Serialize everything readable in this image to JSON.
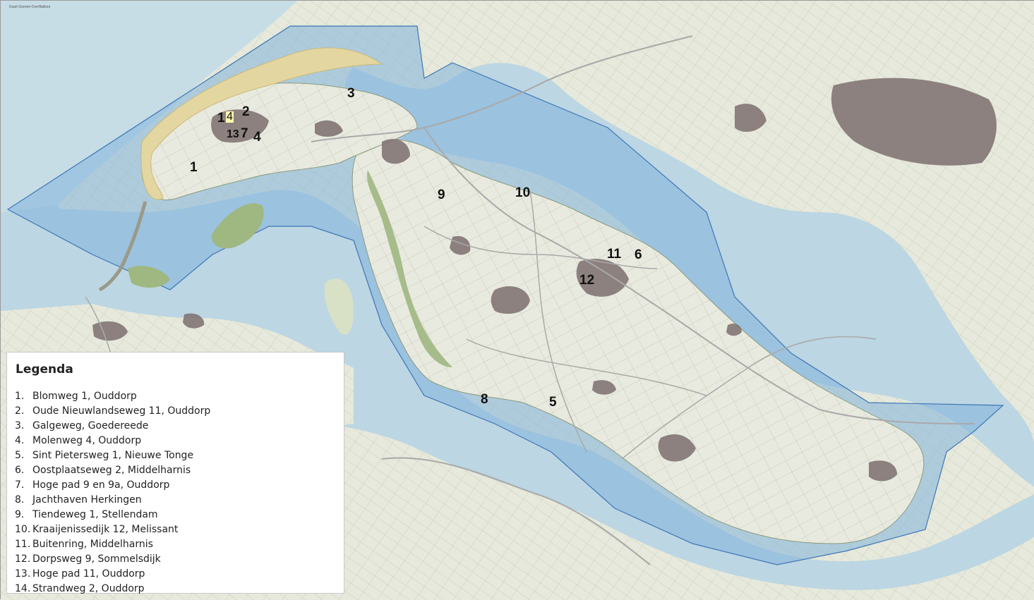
{
  "map": {
    "top_left_caption": "Kaart Goeree-Overflakkee",
    "colors": {
      "land": "#e9eadf",
      "water": "#bcd6e3",
      "deep_water": "#8fb8d6",
      "boundary_fill": "#7fb2dc",
      "boundary_line": "#3f76b5",
      "forest": "#9fb781",
      "dune": "#e4d6a0",
      "urban": "#7b6e6e",
      "road": "#a9a9a9"
    },
    "markers": [
      {
        "id": "1",
        "label": "1"
      },
      {
        "id": "2",
        "label": "2"
      },
      {
        "id": "3",
        "label": "3"
      },
      {
        "id": "4",
        "label": "4"
      },
      {
        "id": "5",
        "label": "5"
      },
      {
        "id": "6",
        "label": "6"
      },
      {
        "id": "7",
        "label": "7"
      },
      {
        "id": "8",
        "label": "8"
      },
      {
        "id": "9",
        "label": "9"
      },
      {
        "id": "10",
        "label": "10"
      },
      {
        "id": "11",
        "label": "11"
      },
      {
        "id": "12",
        "label": "12"
      },
      {
        "id": "13",
        "label": "13"
      },
      {
        "id": "14a",
        "label": "1"
      },
      {
        "id": "14b",
        "label": "4"
      }
    ]
  },
  "legend": {
    "title": "Legenda",
    "items": [
      {
        "num": "1.",
        "text": "Blomweg 1, Ouddorp"
      },
      {
        "num": "2.",
        "text": "Oude Nieuwlandseweg 11, Ouddorp"
      },
      {
        "num": "3.",
        "text": "Galgeweg, Goedereede"
      },
      {
        "num": "4.",
        "text": "Molenweg 4, Ouddorp"
      },
      {
        "num": "5.",
        "text": "Sint Pietersweg 1, Nieuwe Tonge"
      },
      {
        "num": "6.",
        "text": "Oostplaatseweg 2, Middelharnis"
      },
      {
        "num": "7.",
        "text": "Hoge pad 9 en 9a, Ouddorp"
      },
      {
        "num": "8.",
        "text": "Jachthaven Herkingen"
      },
      {
        "num": "9.",
        "text": "Tiendeweg 1, Stellendam"
      },
      {
        "num": "10.",
        "text": "Kraaijenissedijk 12, Melissant"
      },
      {
        "num": "11.",
        "text": "Buitenring, Middelharnis"
      },
      {
        "num": "12.",
        "text": "Dorpsweg 9, Sommelsdijk"
      },
      {
        "num": "13.",
        "text": "Hoge pad 11, Ouddorp"
      },
      {
        "num": "14.",
        "text": "Strandweg 2, Ouddorp"
      }
    ]
  }
}
